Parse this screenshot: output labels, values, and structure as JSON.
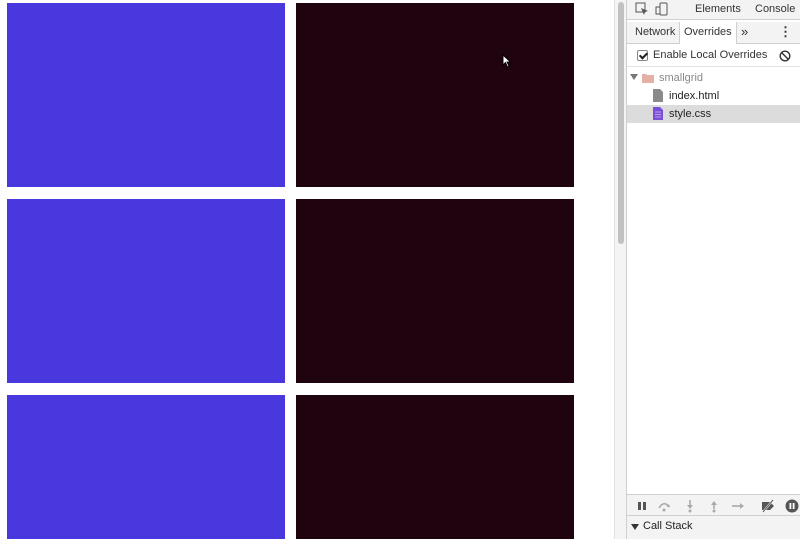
{
  "devtools": {
    "top_tabs": [
      "Elements",
      "Console"
    ],
    "sub_tabs": [
      "Network",
      "Overrides"
    ],
    "active_sub_tab": "Overrides",
    "more_tabs_glyph": "»",
    "menu_glyph": "⋮",
    "overrides": {
      "enable_label": "Enable Local Overrides",
      "enabled": true
    },
    "tree": {
      "folder": "smallgrid",
      "files": [
        "index.html",
        "style.css"
      ],
      "selected_file": "style.css"
    },
    "debugger": {
      "call_stack_label": "Call Stack"
    }
  },
  "icons": {
    "inspect": "inspect-element-icon",
    "device": "device-toolbar-icon",
    "clear": "clear-overrides-icon",
    "folder": "folder-icon",
    "file": "file-icon"
  },
  "colors": {
    "tile_blue": "#4838dd",
    "tile_dark": "#1f030f",
    "selected_row": "#dcdcdc",
    "css_file_icon": "#7a4fd6"
  }
}
